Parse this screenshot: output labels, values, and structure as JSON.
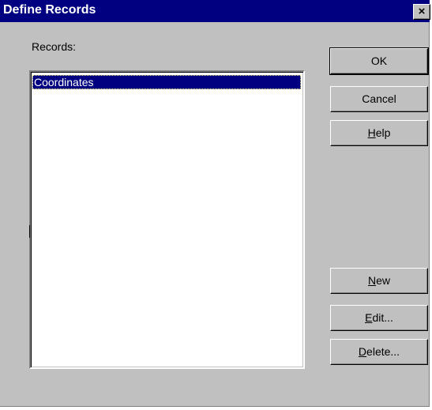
{
  "window": {
    "title": "Define Records",
    "close_glyph": "×"
  },
  "records": {
    "label": "Records:",
    "items": [
      "Coordinates"
    ],
    "selected_index": 0
  },
  "buttons": {
    "ok": "OK",
    "cancel": "Cancel",
    "help": {
      "mnemonic": "H",
      "rest": "elp"
    },
    "new": {
      "mnemonic": "N",
      "rest": "ew"
    },
    "edit": {
      "mnemonic": "E",
      "rest": "dit..."
    },
    "delete": {
      "mnemonic": "D",
      "rest": "elete..."
    }
  },
  "colors": {
    "titlebar": "#000080",
    "face": "#c0c0c0",
    "selection": "#000080"
  }
}
